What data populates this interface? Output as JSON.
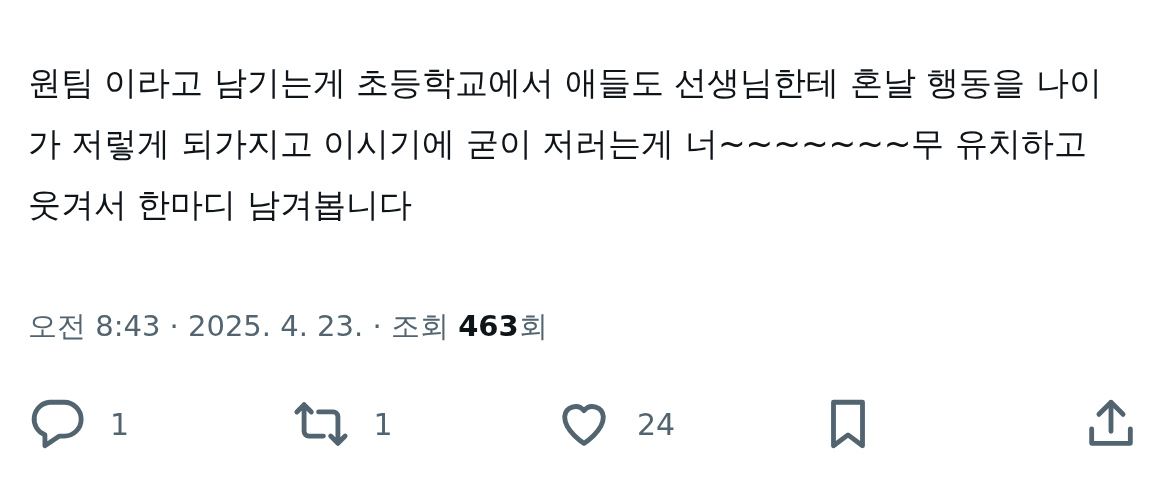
{
  "post": {
    "text": "원팀 이라고 남기는게 초등학교에서 애들도 선생님한테 혼날 행동을 나이가 저렇게 되가지고 이시기에 굳이 저러는게 너~~~~~~~무 유치하고 웃겨서 한마디 남겨봅니다",
    "meta": "오전 8:43 · 2025. 4. 23. · 조회 **463**회"
  },
  "actions": [
    {
      "kind": "reply",
      "count": "1"
    },
    {
      "kind": "repost",
      "count": "1"
    },
    {
      "kind": "like",
      "count": "24"
    },
    {
      "kind": "bookmark"
    },
    {
      "kind": "share"
    }
  ]
}
